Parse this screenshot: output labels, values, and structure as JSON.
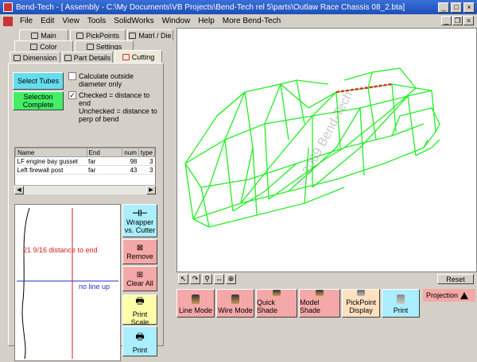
{
  "window": {
    "title": "Bend-Tech - [ Assembly - C:\\My Documents\\VB Projects\\Bend-Tech rel 5\\parts\\Outlaw Race Chassis 08_2.bta]"
  },
  "menu": [
    "File",
    "Edit",
    "View",
    "Tools",
    "SolidWorks",
    "Window",
    "Help",
    "More Bend-Tech"
  ],
  "tabs_row1": [
    "Main",
    "PickPoints",
    "Matrl / Die"
  ],
  "tabs_row2": [
    "Color",
    "Settings"
  ],
  "tabs_row3": [
    "Dimension",
    "Part Details",
    "Cutting"
  ],
  "cutting": {
    "select_tubes": "Select Tubes",
    "selection_complete": "Selection Complete",
    "calc_outside": "Calculate outside diameter only",
    "checked_note": "Checked = distance to end",
    "unchecked_note": "Unchecked = distance to perp of bend",
    "columns": [
      "Name",
      "End",
      "num",
      "type"
    ],
    "rows": [
      [
        "LF engine bay gusset",
        "far",
        "98",
        "3"
      ],
      [
        "Left firewall post",
        "far",
        "43",
        "3"
      ]
    ],
    "distance_label": "21  9/16 distance to end",
    "no_line_up": "no line up",
    "wrapper_btn": "Wrapper vs. Cutter",
    "remove_btn": "Remove",
    "clear_all_btn": "Clear All",
    "print_scale_btn": "Print Scale",
    "print_btn": "Print"
  },
  "viewport": {
    "watermark": "© 2009 Bend-Tech"
  },
  "toolbar": {
    "reset": "Reset"
  },
  "bottom": {
    "line_mode": "Line Mode",
    "wire_mode": "Wire Mode",
    "quick_shade": "Quick Shade",
    "model_shade": "Model Shade",
    "pickpoint_display": "PickPoint Display",
    "print": "Print",
    "projection": "Projection"
  },
  "colors": {
    "chassis": "#22ee22",
    "highlight": "#e03020",
    "accent_blue": "#0000cc",
    "button_green": "#44ee66",
    "button_cyan": "#66ddee",
    "button_pink": "#f4a8a8"
  }
}
